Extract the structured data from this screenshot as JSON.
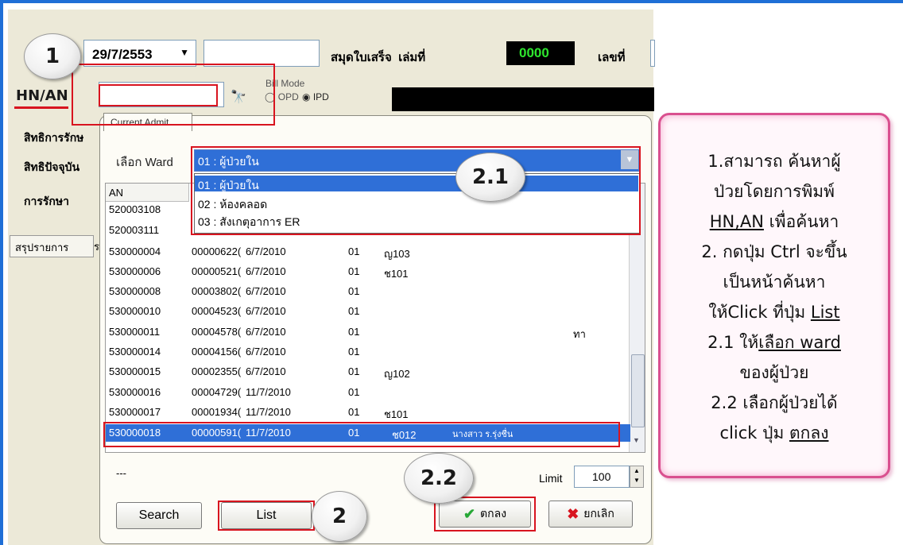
{
  "top": {
    "date": "29/7/2553",
    "receipt_book_label": "สมุดใบเสร็จ  เล่มที่",
    "book_number": "0000",
    "receipt_no_label": "เลขที่",
    "hn_label": "HN/AN",
    "bill_mode_label": "Bill Mode",
    "opd": "OPD",
    "ipd": "IPD"
  },
  "side_labels": [
    "สิทธิการรักษ",
    "สิทธิปัจจุบัน",
    "การรักษา"
  ],
  "tab_left": "สรุปรายการ",
  "tab_left2": "ร",
  "dialog": {
    "tab": "Current Admit",
    "ward_label": "เลือก Ward",
    "ward_selected": "01 : ผู้ป่วยใน",
    "ward_options": [
      "01 : ผู้ป่วยใน",
      "02 : ห้องคลอด",
      "03 : สังเกตุอาการ ER"
    ],
    "col_an": "AN",
    "rows": [
      {
        "an": "520003108",
        "hn": "",
        "date": "",
        "w": "",
        "bed": "",
        "name": ""
      },
      {
        "an": "520003111",
        "hn": "",
        "date": "",
        "w": "01",
        "bed": "",
        "name": ""
      },
      {
        "an": "530000004",
        "hn": "00000622(",
        "date": "6/7/2010",
        "w": "01",
        "bed": "ญ103",
        "name": ""
      },
      {
        "an": "530000006",
        "hn": "00000521(",
        "date": "6/7/2010",
        "w": "01",
        "bed": "ช101",
        "name": ""
      },
      {
        "an": "530000008",
        "hn": "00003802(",
        "date": "6/7/2010",
        "w": "01",
        "bed": "",
        "name": ""
      },
      {
        "an": "530000010",
        "hn": "00004523(",
        "date": "6/7/2010",
        "w": "01",
        "bed": "",
        "name": ""
      },
      {
        "an": "530000011",
        "hn": "00004578(",
        "date": "6/7/2010",
        "w": "01",
        "bed": "",
        "name": "ทา"
      },
      {
        "an": "530000014",
        "hn": "00004156(",
        "date": "6/7/2010",
        "w": "01",
        "bed": "",
        "name": ""
      },
      {
        "an": "530000015",
        "hn": "00002355(",
        "date": "6/7/2010",
        "w": "01",
        "bed": "ญ102",
        "name": ""
      },
      {
        "an": "530000016",
        "hn": "00004729(",
        "date": "11/7/2010",
        "w": "01",
        "bed": "",
        "name": ""
      },
      {
        "an": "530000017",
        "hn": "00001934(",
        "date": "11/7/2010",
        "w": "01",
        "bed": "ช101",
        "name": ""
      },
      {
        "an": "530000018",
        "hn": "00000591(",
        "date": "11/7/2010",
        "w": "01",
        "bed": "ช012",
        "name": "นางสาว ร.รุ่งชื่น"
      }
    ],
    "status_dash": "---",
    "limit_label": "Limit",
    "limit_value": "100",
    "search_btn": "Search",
    "list_btn": "List",
    "ok_btn": "ตกลง",
    "cancel_btn": "ยกเลิก"
  },
  "callouts": [
    "1",
    "2.1",
    "2.2",
    "2"
  ],
  "note": {
    "line1": "1.สามารถ ค้นหาผู้",
    "line2": "ป่วยโดยการพิมพ์",
    "line3a": "HN,AN",
    "line3b": " เพื่อค้นหา",
    "line4": "2. กดปุ่ม Ctrl จะขึ้น",
    "line5": "เป็นหน้าค้นหา",
    "line6a": "ให้Click ที่ปุ่ม ",
    "line6b": "List",
    "line7a": "2.1 ให้",
    "line7b": "เลือก ward",
    "line8": "ของผู้ป่วย",
    "line9": "2.2 เลือกผู้ป่วยได้",
    "line10a": "click ปุ่ม ",
    "line10b": "ตกลง"
  },
  "colors": {
    "accent_red": "#d8141f",
    "select_blue": "#2f6fd7",
    "note_border": "#d9508f"
  }
}
